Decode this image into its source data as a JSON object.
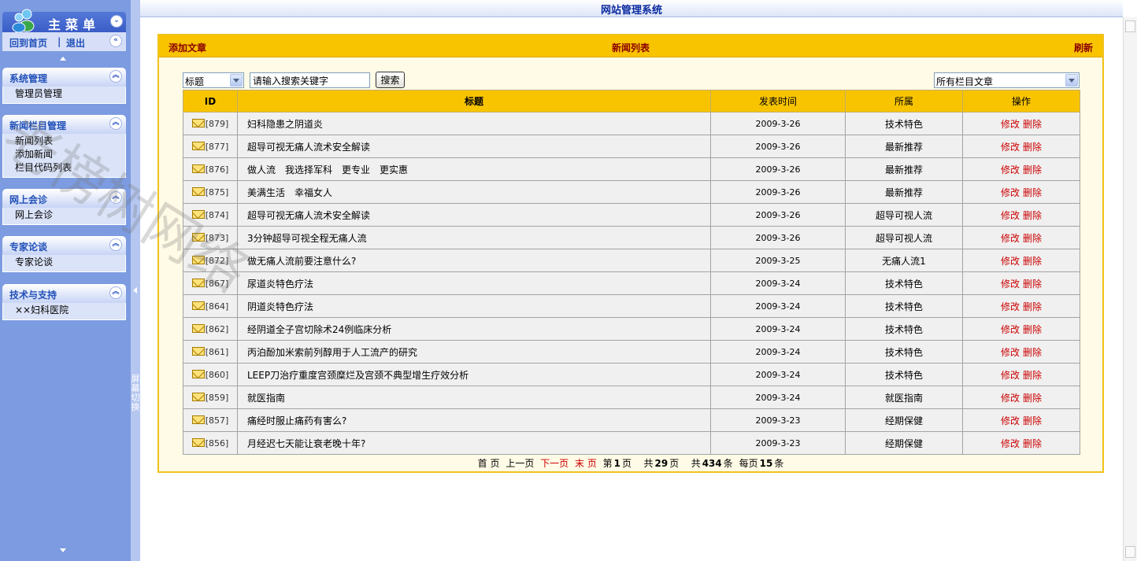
{
  "sidebar": {
    "menu_title": "主菜单",
    "home_link": "回到首页",
    "separator": "|",
    "logout_link": "退出",
    "groups": [
      {
        "title": "系统管理",
        "items": [
          "管理员管理"
        ]
      },
      {
        "title": "新闻栏目管理",
        "items": [
          "新闻列表",
          "添加新闻",
          "栏目代码列表"
        ]
      },
      {
        "title": "网上会诊",
        "items": [
          "网上会诊"
        ]
      },
      {
        "title": "专家论谈",
        "items": [
          "专家论谈"
        ]
      },
      {
        "title": "技术与支持",
        "items": [
          "××妇科医院"
        ]
      }
    ],
    "splitter_label": "屏幕切换"
  },
  "header": {
    "system_title": "网站管理系统"
  },
  "panel": {
    "add_article": "添加文章",
    "list_title": "新闻列表",
    "refresh": "刷新"
  },
  "search": {
    "field_select": "标题",
    "placeholder": "请输入搜索关键字",
    "value": "请输入搜索关键字",
    "button": "搜索",
    "category_select": "所有栏目文章"
  },
  "table": {
    "headers": {
      "id": "ID",
      "title": "标题",
      "date": "发表时间",
      "category": "所属",
      "actions": "操作"
    },
    "edit_label": "修改",
    "delete_label": "删除",
    "rows": [
      {
        "id": "[879]",
        "title": "妇科隐患之阴道炎",
        "date": "2009-3-26",
        "category": "技术特色"
      },
      {
        "id": "[877]",
        "title": "超导可视无痛人流术安全解读",
        "date": "2009-3-26",
        "category": "最新推荐"
      },
      {
        "id": "[876]",
        "title": "做人流　我选择军科　更专业　更实惠",
        "date": "2009-3-26",
        "category": "最新推荐"
      },
      {
        "id": "[875]",
        "title": "美满生活　幸福女人",
        "date": "2009-3-26",
        "category": "最新推荐"
      },
      {
        "id": "[874]",
        "title": "超导可视无痛人流术安全解读",
        "date": "2009-3-26",
        "category": "超导可视人流"
      },
      {
        "id": "[873]",
        "title": "3分钟超导可视全程无痛人流",
        "date": "2009-3-26",
        "category": "超导可视人流"
      },
      {
        "id": "[872]",
        "title": "做无痛人流前要注意什么?",
        "date": "2009-3-25",
        "category": "无痛人流1"
      },
      {
        "id": "[867]",
        "title": "尿道炎特色疗法",
        "date": "2009-3-24",
        "category": "技术特色"
      },
      {
        "id": "[864]",
        "title": "阴道炎特色疗法",
        "date": "2009-3-24",
        "category": "技术特色"
      },
      {
        "id": "[862]",
        "title": "经阴道全子宫切除术24例临床分析",
        "date": "2009-3-24",
        "category": "技术特色"
      },
      {
        "id": "[861]",
        "title": "丙泊酚加米索前列醇用于人工流产的研究",
        "date": "2009-3-24",
        "category": "技术特色"
      },
      {
        "id": "[860]",
        "title": "LEEP刀治疗重度宫颈糜烂及宫颈不典型增生疗效分析",
        "date": "2009-3-24",
        "category": "技术特色"
      },
      {
        "id": "[859]",
        "title": "就医指南",
        "date": "2009-3-24",
        "category": "就医指南"
      },
      {
        "id": "[857]",
        "title": "痛经时服止痛药有害么?",
        "date": "2009-3-23",
        "category": "经期保健"
      },
      {
        "id": "[856]",
        "title": "月经迟七天能让衰老晚十年?",
        "date": "2009-3-23",
        "category": "经期保健"
      }
    ]
  },
  "pager": {
    "first": "首 页",
    "prev": "上一页",
    "next": "下一页",
    "last": "末 页",
    "page_prefix": "第",
    "current_page": "1",
    "page_suffix": "页",
    "total_prefix": "共",
    "total_pages": "29",
    "total_pages_suffix": "页",
    "records_prefix": "共",
    "total_records": "434",
    "records_suffix": "条",
    "per_page_prefix": "每页",
    "per_page": "15",
    "per_page_suffix": "条"
  },
  "watermark": "老榜树网络",
  "colors": {
    "sidebar_bg": "#7c9be0",
    "panel_header": "#f8c400",
    "action_red": "#cc0000",
    "title_blue": "#0a2a9f"
  }
}
